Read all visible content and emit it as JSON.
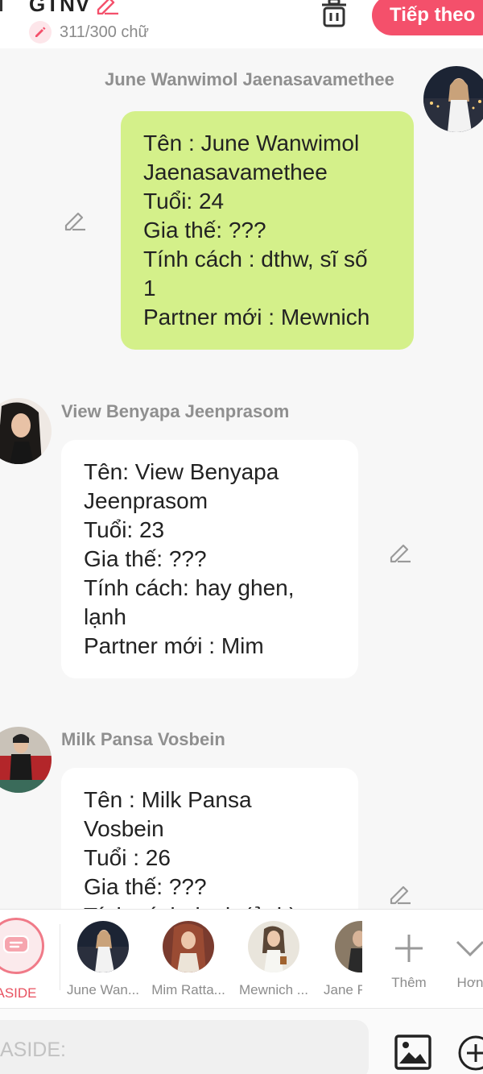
{
  "header": {
    "title": "GTNV",
    "word_count": "311/300 chữ",
    "next_label": "Tiếp theo",
    "accent": "#f4506b"
  },
  "messages": [
    {
      "sender": "June Wanwimol Jaenasavamethee",
      "side": "right",
      "bubble_color": "#d4f08a",
      "lines": [
        "Tên : June Wanwimol",
        "Jaenasavamethee",
        "Tuổi: 24",
        "Gia thế: ???",
        "Tính cách : dthw, sĩ số",
        "1",
        "Partner mới : Mewnich"
      ]
    },
    {
      "sender": "View Benyapa Jeenprasom",
      "side": "left",
      "bubble_color": "#ffffff",
      "lines": [
        "Tên: View Benyapa",
        "Jeenprasom",
        "Tuổi: 23",
        "Gia thế: ???",
        "Tính cách: hay ghen,",
        "lạnh",
        "Partner mới : Mim"
      ]
    },
    {
      "sender": "Milk Pansa Vosbein",
      "side": "left",
      "bubble_color": "#ffffff",
      "lines": [
        "Tên : Milk Pansa",
        "Vosbein",
        "Tuổi : 26",
        "Gia thế: ???",
        "Tính cách: lạnh (ảnh)"
      ]
    }
  ],
  "characters": [
    {
      "label": "ASIDE",
      "icon": "aside-chat-icon"
    },
    {
      "label": "June Wan..."
    },
    {
      "label": "Mim Ratta..."
    },
    {
      "label": "Mewnich ..."
    },
    {
      "label": "Jane F"
    }
  ],
  "actions": {
    "add_label": "Thêm",
    "more_label": "Hơn"
  },
  "input": {
    "placeholder": "ASIDE:"
  }
}
